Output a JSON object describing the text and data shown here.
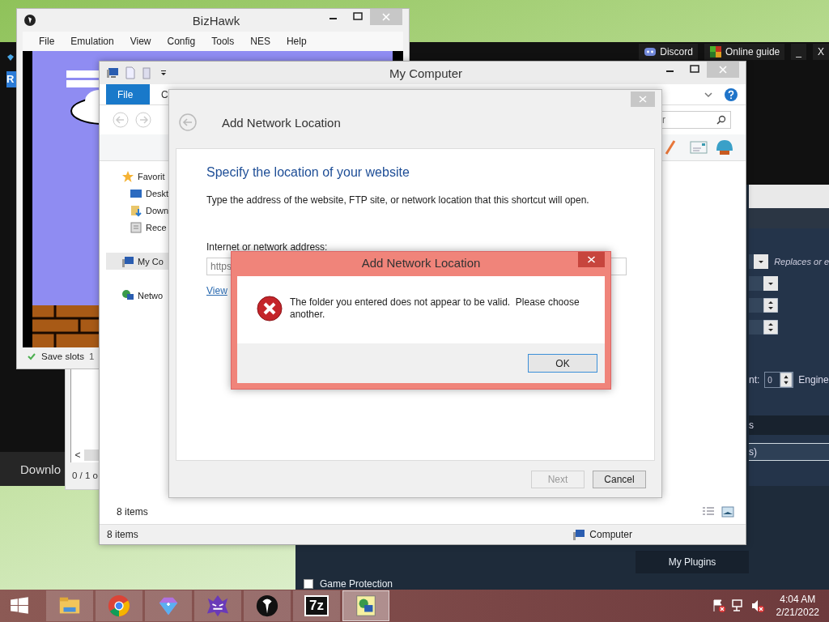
{
  "launcher": {
    "side_badge": "R",
    "download_label": "Downlo",
    "buttons": [
      {
        "label": "Discord",
        "kind": "discord"
      },
      {
        "label": "Online guide",
        "kind": "guide"
      },
      {
        "label": "_",
        "kind": "plain"
      },
      {
        "label": "X",
        "kind": "plain"
      }
    ]
  },
  "plugin_panel": {
    "rows": [
      {
        "kind": "dropdown",
        "note": "Replaces or e"
      },
      {
        "kind": "dropdown"
      },
      {
        "kind": "spinner"
      },
      {
        "kind": "spinner"
      }
    ],
    "count_label": "nt:",
    "count_value": "0",
    "engine_label": "Engine",
    "section_1": "s",
    "section_2": "s)",
    "plugins_button": "My Plugins",
    "game_protection": {
      "label": "Game Protection",
      "checked": false
    }
  },
  "back_window": {
    "scroll_left": "<",
    "status": "0 / 1 o"
  },
  "bizhawk": {
    "title": "BizHawk",
    "menu": [
      "File",
      "Emulation",
      "View",
      "Config",
      "Tools",
      "NES",
      "Help"
    ],
    "status": {
      "label": "Save slots",
      "value": "1"
    }
  },
  "explorer": {
    "title": "My Computer",
    "ribbon_tabs": [
      {
        "label": "File",
        "selected": true
      },
      {
        "label": "C",
        "selected": false
      }
    ],
    "search": {
      "placeholder": "r"
    },
    "nav": [
      {
        "label": "Favorit",
        "kind": "star",
        "selected": false,
        "children": [
          {
            "label": "Deskt",
            "kind": "desktop",
            "selected": false
          },
          {
            "label": "Down",
            "kind": "downloads",
            "selected": false
          },
          {
            "label": "Rece",
            "kind": "recent",
            "selected": false
          }
        ]
      },
      {
        "label": "My Co",
        "kind": "computer",
        "selected": true
      },
      {
        "label": "Netwo",
        "kind": "network",
        "selected": false
      }
    ],
    "item_count": "8 items",
    "status": {
      "count": "8 items",
      "location": "Computer"
    }
  },
  "wizard": {
    "title": "Add Network Location",
    "heading": "Specify the location of your website",
    "description": "Type the address of the website, FTP site, or network location that this shortcut will open.",
    "address_label": "Internet or network address:",
    "address_value": "https",
    "link": "View",
    "buttons": [
      {
        "label": "Next",
        "disabled": true
      },
      {
        "label": "Cancel",
        "disabled": false
      }
    ]
  },
  "error_dialog": {
    "title": "Add Network Location",
    "message": "The folder you entered does not appear to be valid.  Please choose another.",
    "ok": "OK"
  },
  "taskbar": {
    "apps": [
      {
        "kind": "explorer",
        "selected": false
      },
      {
        "kind": "chrome",
        "selected": false
      },
      {
        "kind": "gem",
        "selected": false
      },
      {
        "kind": "monster",
        "selected": false
      },
      {
        "kind": "eagle",
        "selected": false
      },
      {
        "kind": "sevenzip",
        "label": "7z",
        "selected": false
      },
      {
        "kind": "netapp",
        "selected": true
      }
    ],
    "time": "4:04 AM",
    "date": "2/21/2022"
  }
}
